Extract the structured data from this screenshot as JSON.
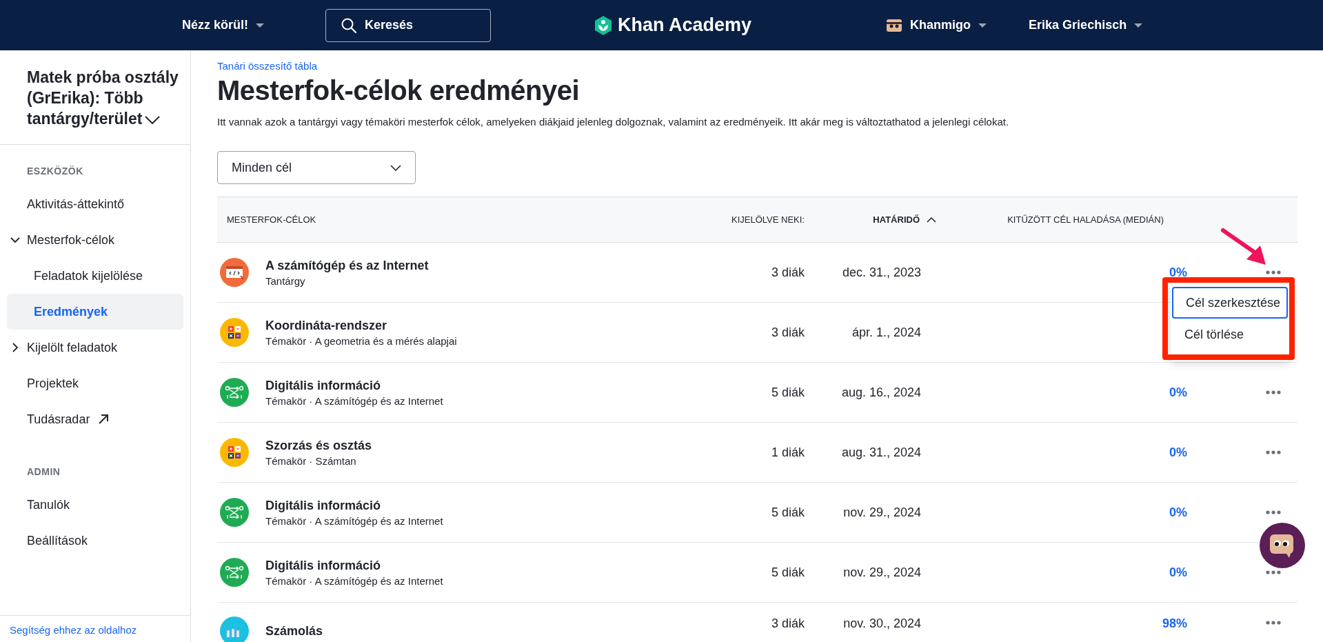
{
  "topbar": {
    "explore": "Nézz körül!",
    "search": {
      "placeholder": "Keresés"
    },
    "logo": "Khan Academy",
    "assistant": "Khanmigo",
    "user": "Erika Griechisch"
  },
  "sidebar": {
    "class_title": "Matek próba osztály (GrErika): Több tantárgy/terület",
    "sections": [
      {
        "heading": "ESZKÖZÖK",
        "items": [
          {
            "label": "Aktivitás-áttekintő",
            "selected": false,
            "kind": "link"
          },
          {
            "label": "Mesterfok-célok",
            "selected": false,
            "kind": "group",
            "expanded": true,
            "children": [
              {
                "label": "Feladatok kijelölése",
                "selected": false,
                "kind": "link"
              },
              {
                "label": "Eredmények",
                "selected": true,
                "kind": "link"
              }
            ]
          },
          {
            "label": "Kijelölt feladatok",
            "selected": false,
            "kind": "group",
            "expanded": false
          },
          {
            "label": "Projektek",
            "selected": false,
            "kind": "link"
          },
          {
            "label": "Tudásradar",
            "selected": false,
            "kind": "external"
          }
        ]
      },
      {
        "heading": "ADMIN",
        "items": [
          {
            "label": "Tanulók",
            "selected": false,
            "kind": "link"
          },
          {
            "label": "Beállítások",
            "selected": false,
            "kind": "link"
          }
        ]
      }
    ],
    "help_link": "Segítség ehhez az oldalhoz"
  },
  "breadcrumb": "Tanári összesítő tábla",
  "title": "Mesterfok-célok eredményei",
  "description": "Itt vannak azok a tantárgyi vagy témaköri mesterfok célok, amelyeken diákjaid jelenleg dolgoznak, valamint az eredményeik. Itt akár meg is változtathatod a jelenlegi célokat.",
  "filter": {
    "value": "Minden cél"
  },
  "table": {
    "columns": [
      {
        "label": "MESTERFOK-CÉLOK",
        "sorted": false
      },
      {
        "label": "KIJELÖLVE NEKI:",
        "sorted": false
      },
      {
        "label": "HATÁRIDŐ",
        "sorted": true
      },
      {
        "label": "KITŰZÖTT CÉL HALADÁSA (MEDIÁN)",
        "sorted": false
      }
    ],
    "rows": [
      {
        "kind": "computing",
        "title": "A számítógép és az Internet",
        "subtitle": "Tantárgy",
        "assigned": "3 diák",
        "due": "dec. 31., 2023",
        "progress": "0%",
        "menu": {
          "items": [
            {
              "label": "Cél szerkesztése",
              "selected": true
            },
            {
              "label": "Cél törlése",
              "selected": false
            }
          ]
        }
      },
      {
        "kind": "arithmetic",
        "title": "Koordináta-rendszer",
        "subtitle": "Témakör · A geometria és a mérés alapjai",
        "assigned": "3 diák",
        "due": "ápr. 1., 2024"
      },
      {
        "kind": "binary",
        "title": "Digitális információ",
        "subtitle": "Témakör · A számítógép és az Internet",
        "assigned": "5 diák",
        "due": "aug. 16., 2024",
        "progress": "0%"
      },
      {
        "kind": "arithmetic",
        "title": "Szorzás és osztás",
        "subtitle": "Témakör · Számtan",
        "assigned": "1 diák",
        "due": "aug. 31., 2024",
        "progress": "0%"
      },
      {
        "kind": "binary",
        "title": "Digitális információ",
        "subtitle": "Témakör · A számítógép és az Internet",
        "assigned": "5 diák",
        "due": "nov. 29., 2024",
        "progress": "0%"
      },
      {
        "kind": "binary",
        "title": "Digitális információ",
        "subtitle": "Témakör · A számítógép és az Internet",
        "assigned": "5 diák",
        "due": "nov. 29., 2024",
        "progress": "0%"
      },
      {
        "kind": "counting",
        "title": "Számolás",
        "assigned": "3 diák",
        "due": "nov. 30., 2024",
        "progress": "98%"
      }
    ]
  }
}
